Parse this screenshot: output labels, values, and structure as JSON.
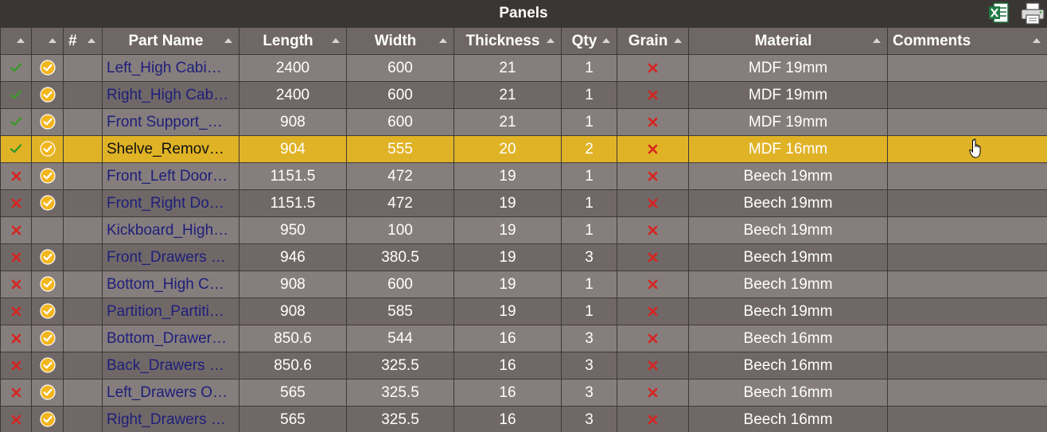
{
  "window": {
    "title": "Panels"
  },
  "toolbar": {
    "excel_icon": "excel-icon",
    "print_icon": "printer-icon"
  },
  "colors": {
    "check": "#3a9a2a",
    "cross": "#d8231f",
    "badge": "#f3b61c",
    "selected_row": "#e0b326",
    "name_text": "#1e1f7a"
  },
  "columns": [
    {
      "label": ""
    },
    {
      "label": ""
    },
    {
      "label": "#"
    },
    {
      "label": "Part Name"
    },
    {
      "label": "Length"
    },
    {
      "label": "Width"
    },
    {
      "label": "Thickness"
    },
    {
      "label": "Qty"
    },
    {
      "label": "Grain"
    },
    {
      "label": "Material"
    },
    {
      "label": "Comments"
    }
  ],
  "rows": [
    {
      "status": "check",
      "badge": true,
      "num": "",
      "name": "Left_High Cabi…",
      "length": "2400",
      "width": "600",
      "thickness": "21",
      "qty": "1",
      "grain": "cross",
      "material": "MDF 19mm",
      "comments": ""
    },
    {
      "status": "check",
      "badge": true,
      "num": "",
      "name": "Right_High Cab…",
      "length": "2400",
      "width": "600",
      "thickness": "21",
      "qty": "1",
      "grain": "cross",
      "material": "MDF 19mm",
      "comments": ""
    },
    {
      "status": "check",
      "badge": true,
      "num": "",
      "name": "Front Support_…",
      "length": "908",
      "width": "600",
      "thickness": "21",
      "qty": "1",
      "grain": "cross",
      "material": "MDF 19mm",
      "comments": ""
    },
    {
      "status": "check",
      "badge": true,
      "num": "",
      "name": "Shelve_Remov…",
      "length": "904",
      "width": "555",
      "thickness": "20",
      "qty": "2",
      "grain": "cross",
      "material": "MDF 16mm",
      "comments": "",
      "selected": true
    },
    {
      "status": "cross",
      "badge": true,
      "num": "",
      "name": "Front_Left Door…",
      "length": "1151.5",
      "width": "472",
      "thickness": "19",
      "qty": "1",
      "grain": "cross",
      "material": "Beech 19mm",
      "comments": ""
    },
    {
      "status": "cross",
      "badge": true,
      "num": "",
      "name": "Front_Right Do…",
      "length": "1151.5",
      "width": "472",
      "thickness": "19",
      "qty": "1",
      "grain": "cross",
      "material": "Beech 19mm",
      "comments": ""
    },
    {
      "status": "cross",
      "badge": false,
      "num": "",
      "name": "Kickboard_High…",
      "length": "950",
      "width": "100",
      "thickness": "19",
      "qty": "1",
      "grain": "cross",
      "material": "Beech 19mm",
      "comments": ""
    },
    {
      "status": "cross",
      "badge": true,
      "num": "",
      "name": "Front_Drawers …",
      "length": "946",
      "width": "380.5",
      "thickness": "19",
      "qty": "3",
      "grain": "cross",
      "material": "Beech 19mm",
      "comments": ""
    },
    {
      "status": "cross",
      "badge": true,
      "num": "",
      "name": "Bottom_High C…",
      "length": "908",
      "width": "600",
      "thickness": "19",
      "qty": "1",
      "grain": "cross",
      "material": "Beech 19mm",
      "comments": ""
    },
    {
      "status": "cross",
      "badge": true,
      "num": "",
      "name": "Partition_Partiti…",
      "length": "908",
      "width": "585",
      "thickness": "19",
      "qty": "1",
      "grain": "cross",
      "material": "Beech 19mm",
      "comments": ""
    },
    {
      "status": "cross",
      "badge": true,
      "num": "",
      "name": "Bottom_Drawer…",
      "length": "850.6",
      "width": "544",
      "thickness": "16",
      "qty": "3",
      "grain": "cross",
      "material": "Beech 16mm",
      "comments": ""
    },
    {
      "status": "cross",
      "badge": true,
      "num": "",
      "name": "Back_Drawers …",
      "length": "850.6",
      "width": "325.5",
      "thickness": "16",
      "qty": "3",
      "grain": "cross",
      "material": "Beech 16mm",
      "comments": ""
    },
    {
      "status": "cross",
      "badge": true,
      "num": "",
      "name": "Left_Drawers O…",
      "length": "565",
      "width": "325.5",
      "thickness": "16",
      "qty": "3",
      "grain": "cross",
      "material": "Beech 16mm",
      "comments": ""
    },
    {
      "status": "cross",
      "badge": true,
      "num": "",
      "name": "Right_Drawers …",
      "length": "565",
      "width": "325.5",
      "thickness": "16",
      "qty": "3",
      "grain": "cross",
      "material": "Beech 16mm",
      "comments": ""
    }
  ]
}
